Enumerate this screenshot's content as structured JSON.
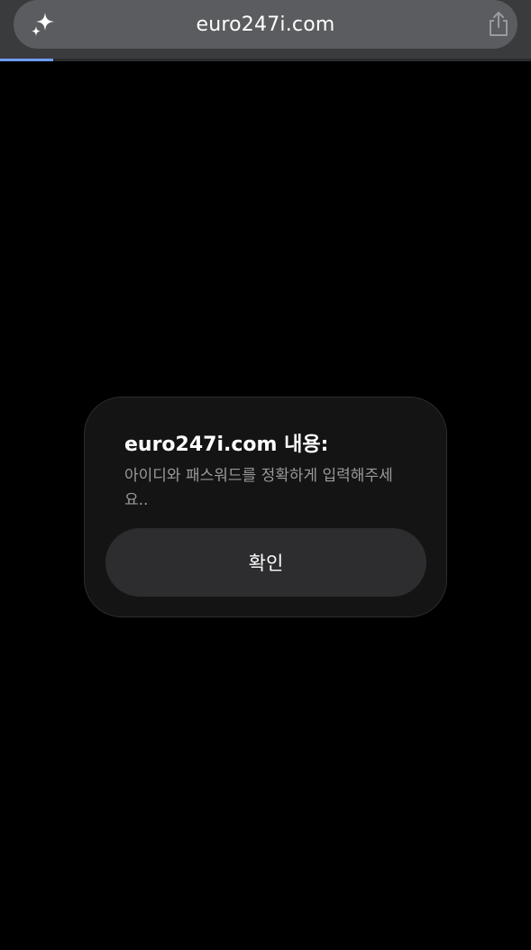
{
  "browser": {
    "url": "euro247i.com",
    "ai_icon": "sparkle-icon",
    "share_icon": "share-icon",
    "load_progress": 0.1
  },
  "dialog": {
    "title": "euro247i.com 내용:",
    "message": "아이디와 패스워드를 정확하게 입력해주세요..",
    "confirm_label": "확인"
  },
  "colors": {
    "accent_progress": "#6d9bf0"
  }
}
